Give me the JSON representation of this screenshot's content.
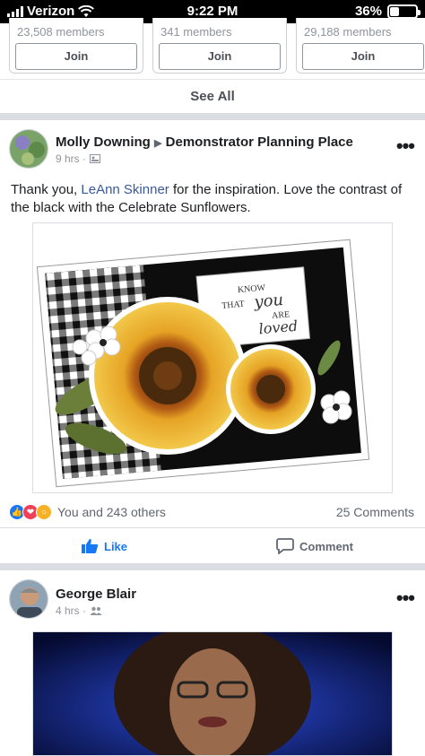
{
  "status": {
    "carrier": "Verizon",
    "time": "9:22 PM",
    "battery": "36%",
    "battery_level": 0.36
  },
  "groups": [
    {
      "members": "23,508 members",
      "join_label": "Join"
    },
    {
      "members": "341 members",
      "join_label": "Join"
    },
    {
      "members": "29,188 members",
      "join_label": "Join"
    }
  ],
  "see_all": "See All",
  "post1": {
    "author": "Molly Downing",
    "group": "Demonstrator Planning Place",
    "time": "9 hrs ·",
    "text_before": "Thank you, ",
    "link_text": "LeAnn Skinner",
    "text_after": " for the inspiration. Love the contrast of the black with the Celebrate Sunflowers.",
    "card_text": {
      "line1": "KNOW",
      "line2": "THAT",
      "line3": "you",
      "line4": "ARE",
      "line5": "loved"
    },
    "reactions_text": "You and 243 others",
    "comments": "25 Comments",
    "like_label": "Like",
    "comment_label": "Comment"
  },
  "post2": {
    "author": "George Blair",
    "time": "4 hrs ·"
  },
  "colors": {
    "fb_blue": "#385898",
    "like_blue": "#1877f2",
    "love_red": "#f33e58",
    "wow_yellow": "#f7b125"
  },
  "icons": [
    "wifi-icon",
    "signal-icon",
    "battery-icon",
    "globe-icon",
    "friends-icon",
    "more-icon",
    "like-icon",
    "comment-icon"
  ]
}
